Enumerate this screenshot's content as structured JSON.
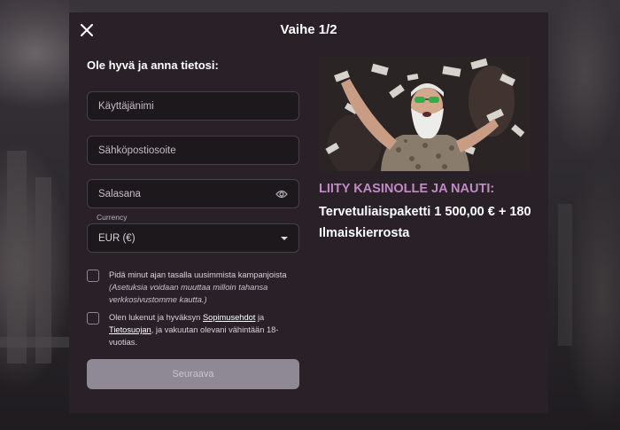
{
  "modal": {
    "step_title": "Vaihe 1/2",
    "intro": "Ole hyvä ja anna tietosi:"
  },
  "form": {
    "username_placeholder": "Käyttäjänimi",
    "email_placeholder": "Sähköpostiosoite",
    "password_placeholder": "Salasana",
    "currency_label": "Currency",
    "currency_value": "EUR (€)",
    "newsletter_text": "Pidä minut ajan tasalla uusimmista kampanjoista",
    "newsletter_note": "(Asetuksia voidaan muuttaa milloin tahansa verkkosivustomme kautta.)",
    "terms_prefix": "Olen lukenut ja hyväksyn",
    "terms_link": "Sopimusehdot",
    "terms_and": "ja",
    "privacy_link": "Tietosuojan",
    "terms_suffix": ", ja vakuutan olevani vähintään 18-vuotias.",
    "next_button": "Seuraava"
  },
  "promo": {
    "heading": "LIITY KASINOLLE JA NAUTI:",
    "body": "Tervetuliaispaketti 1 500,00 € + 180 Ilmaiskierrosta"
  },
  "colors": {
    "modal_bg": "#2a2128",
    "accent_heading": "#c08ac4",
    "button_disabled": "#8f8996"
  },
  "icons": [
    "close-icon",
    "eye-icon",
    "chevron-down-icon"
  ]
}
